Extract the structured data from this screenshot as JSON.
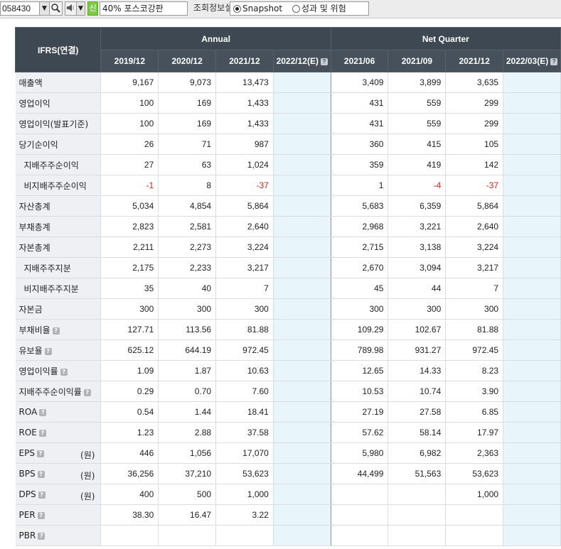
{
  "toolbar": {
    "stock_code": "058430",
    "shin_badge": "신",
    "company_name": "40% 포스코강판",
    "settings_label": "조회정보설정",
    "radio_snapshot": "Snapshot",
    "radio_risk": "성과 및 위험"
  },
  "table": {
    "corner_label": "IFRS(연결)",
    "group_annual": "Annual",
    "group_quarter": "Net Quarter",
    "periods": [
      "2019/12",
      "2020/12",
      "2021/12",
      "2022/12(E)",
      "2021/06",
      "2021/09",
      "2021/12",
      "2022/03(E)"
    ],
    "rows": [
      {
        "label": "매출액",
        "unit": "",
        "values": [
          "9,167",
          "9,073",
          "13,473",
          "",
          "3,409",
          "3,899",
          "3,635",
          ""
        ]
      },
      {
        "label": "영업이익",
        "unit": "",
        "values": [
          "100",
          "169",
          "1,433",
          "",
          "431",
          "559",
          "299",
          ""
        ]
      },
      {
        "label": "영업이익(발표기준)",
        "unit": "",
        "values": [
          "100",
          "169",
          "1,433",
          "",
          "431",
          "559",
          "299",
          ""
        ]
      },
      {
        "label": "당기순이익",
        "unit": "",
        "values": [
          "26",
          "71",
          "987",
          "",
          "360",
          "415",
          "105",
          ""
        ]
      },
      {
        "label": "지배주주순이익",
        "unit": "",
        "values": [
          "27",
          "63",
          "1,024",
          "",
          "359",
          "419",
          "142",
          ""
        ]
      },
      {
        "label": "비지배주주순이익",
        "unit": "",
        "values": [
          "-1",
          "8",
          "-37",
          "",
          "1",
          "-4",
          "-37",
          ""
        ]
      },
      {
        "label": "자산총계",
        "unit": "",
        "values": [
          "5,034",
          "4,854",
          "5,864",
          "",
          "5,683",
          "6,359",
          "5,864",
          ""
        ]
      },
      {
        "label": "부채총계",
        "unit": "",
        "values": [
          "2,823",
          "2,581",
          "2,640",
          "",
          "2,968",
          "3,221",
          "2,640",
          ""
        ]
      },
      {
        "label": "자본총계",
        "unit": "",
        "values": [
          "2,211",
          "2,273",
          "3,224",
          "",
          "2,715",
          "3,138",
          "3,224",
          ""
        ]
      },
      {
        "label": "지배주주지분",
        "unit": "",
        "values": [
          "2,175",
          "2,233",
          "3,217",
          "",
          "2,670",
          "3,094",
          "3,217",
          ""
        ]
      },
      {
        "label": "비지배주주지분",
        "unit": "",
        "values": [
          "35",
          "40",
          "7",
          "",
          "45",
          "44",
          "7",
          ""
        ]
      },
      {
        "label": "자본금",
        "unit": "",
        "values": [
          "300",
          "300",
          "300",
          "",
          "300",
          "300",
          "300",
          ""
        ]
      },
      {
        "label": "부채비율",
        "unit": "",
        "values": [
          "127.71",
          "113.56",
          "81.88",
          "",
          "109.29",
          "102.67",
          "81.88",
          ""
        ]
      },
      {
        "label": "유보율",
        "unit": "",
        "values": [
          "625.12",
          "644.19",
          "972.45",
          "",
          "789.98",
          "931.27",
          "972.45",
          ""
        ]
      },
      {
        "label": "영업이익률",
        "unit": "",
        "values": [
          "1.09",
          "1.87",
          "10.63",
          "",
          "12.65",
          "14.33",
          "8.23",
          ""
        ]
      },
      {
        "label": "지배주주순이익률",
        "unit": "",
        "values": [
          "0.29",
          "0.70",
          "7.60",
          "",
          "10.53",
          "10.74",
          "3.90",
          ""
        ]
      },
      {
        "label": "ROA",
        "unit": "",
        "values": [
          "0.54",
          "1.44",
          "18.41",
          "",
          "27.19",
          "27.58",
          "6.85",
          ""
        ]
      },
      {
        "label": "ROE",
        "unit": "",
        "values": [
          "1.23",
          "2.88",
          "37.58",
          "",
          "57.62",
          "58.14",
          "17.97",
          ""
        ]
      },
      {
        "label": "EPS",
        "unit": "(원)",
        "values": [
          "446",
          "1,056",
          "17,070",
          "",
          "5,980",
          "6,982",
          "2,363",
          ""
        ]
      },
      {
        "label": "BPS",
        "unit": "(원)",
        "values": [
          "36,256",
          "37,210",
          "53,623",
          "",
          "44,499",
          "51,563",
          "53,623",
          ""
        ]
      },
      {
        "label": "DPS",
        "unit": "(원)",
        "values": [
          "400",
          "500",
          "1,000",
          "",
          "",
          "",
          "1,000",
          ""
        ]
      },
      {
        "label": "PER",
        "unit": "",
        "values": [
          "38.30",
          "16.47",
          "3.22",
          "",
          "",
          "",
          "",
          ""
        ]
      },
      {
        "label": "PBR",
        "unit": "",
        "values": [
          "",
          "",
          "",
          "",
          "",
          "",
          "",
          ""
        ]
      }
    ]
  },
  "colors": {
    "header_bg": "#3d4852",
    "label_bg": "#eef0f3",
    "estimate_bg": "#e8f6fb",
    "negative": "#e0201b"
  }
}
